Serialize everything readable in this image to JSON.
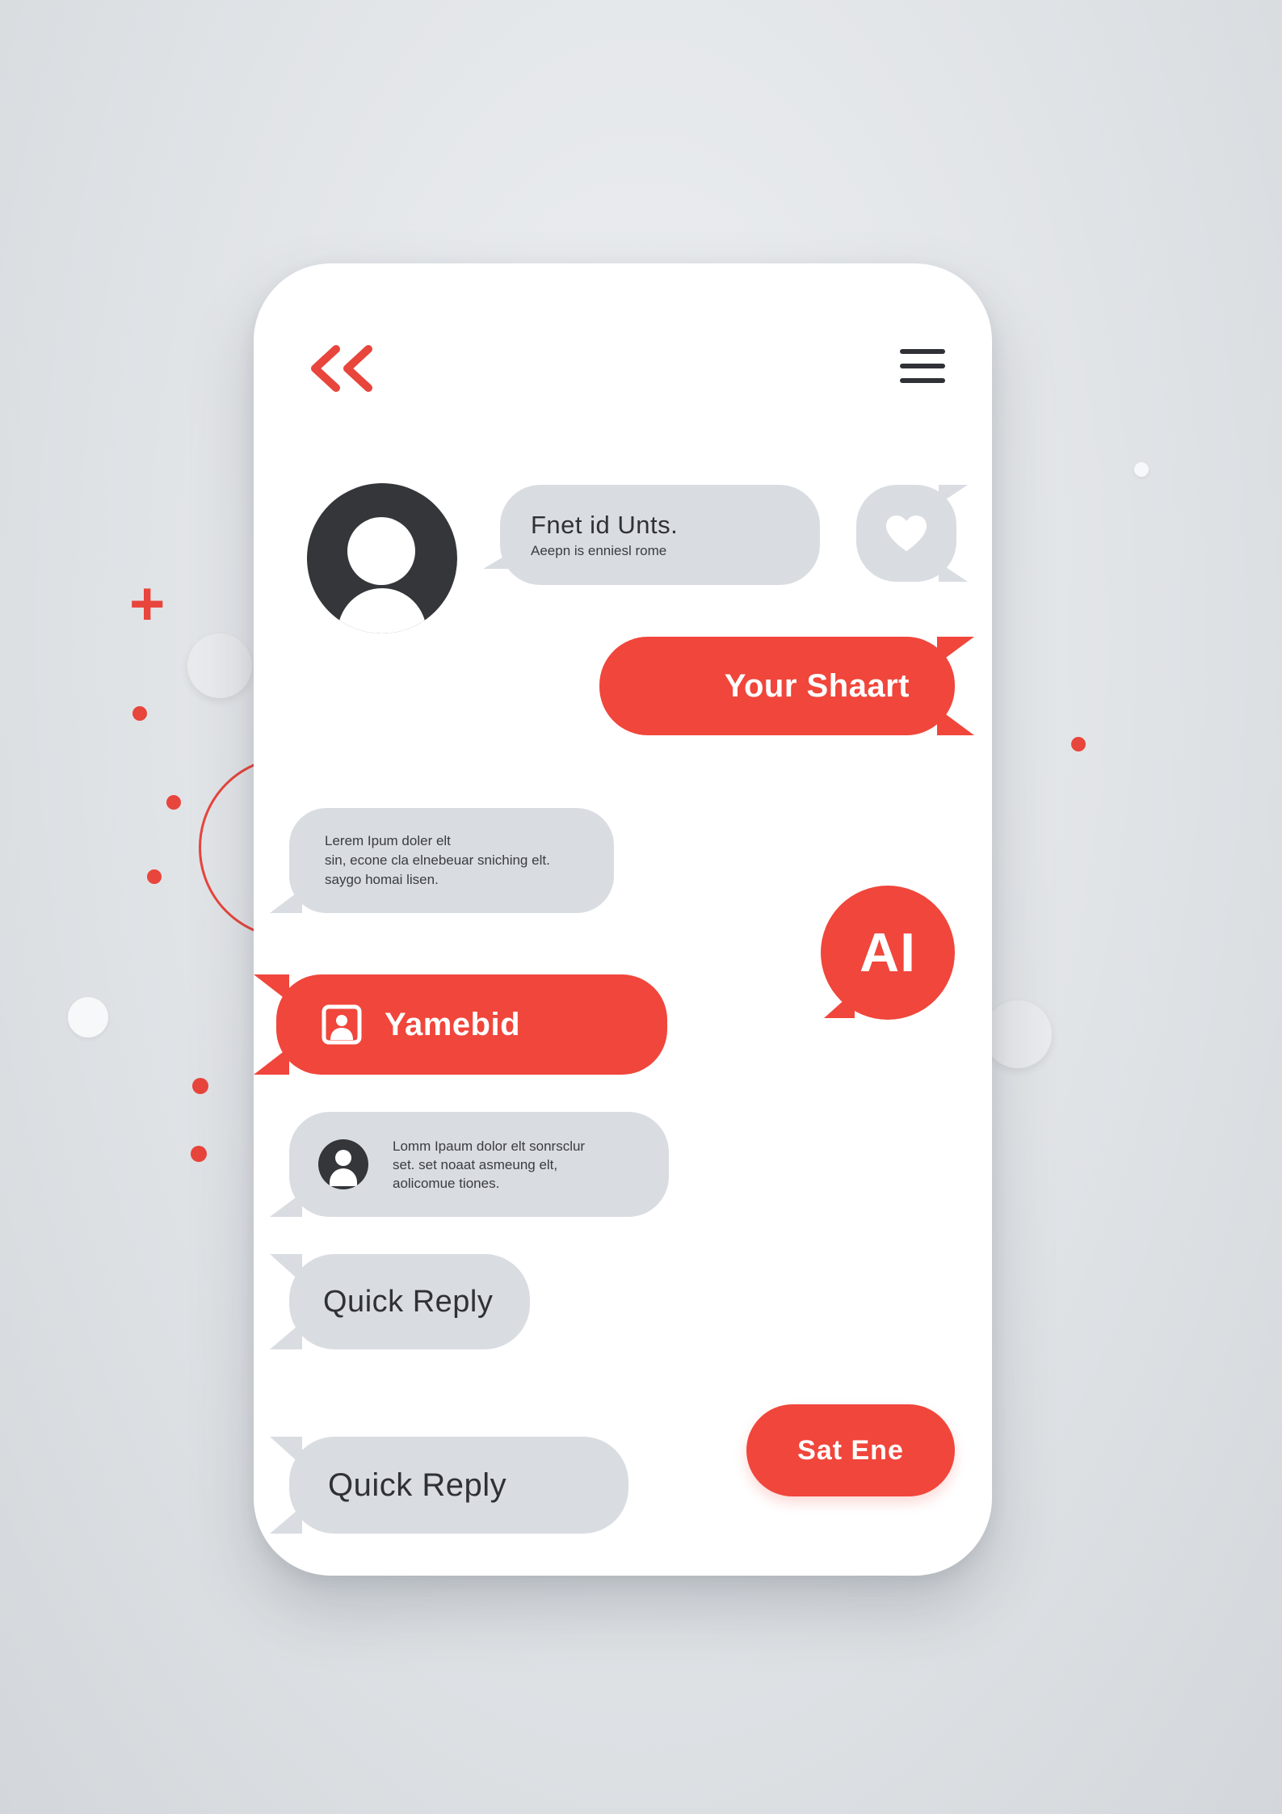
{
  "theme": {
    "accent": "#f0463b",
    "bubble_gray": "#d9dde2",
    "text_dark": "#2f3136",
    "avatar_dark": "#34363a"
  },
  "header": {
    "back_icon": "double-chevron-left-icon",
    "menu_icon": "hamburger-menu-icon"
  },
  "messages": {
    "incoming_title": {
      "title": "Fnet id Unts.",
      "subtitle": "Aeepn is enniesl rome"
    },
    "heart_reaction": {
      "icon": "heart-icon"
    },
    "outgoing_short": {
      "text": "Your Shaart"
    },
    "incoming_lorem": {
      "lines": [
        "Lerem Ipum doler elt",
        "sin, econe cla elnebeuar sniching elt.",
        "saygo homai lisen."
      ]
    },
    "ai_badge": {
      "text": "AI"
    },
    "contact_card": {
      "icon": "contact-card-icon",
      "text": "Yamebid"
    },
    "incoming_with_avatar": {
      "lines": [
        "Lomm Ipaum dolor elt sonrsclur",
        "set. set noaat asmeung elt,",
        "aolicomue tiones."
      ]
    },
    "quick_reply_1": {
      "text": "Quick Reply"
    },
    "quick_reply_2": {
      "text": "Quick Reply"
    },
    "send_button": {
      "text": "Sat Ene"
    }
  }
}
